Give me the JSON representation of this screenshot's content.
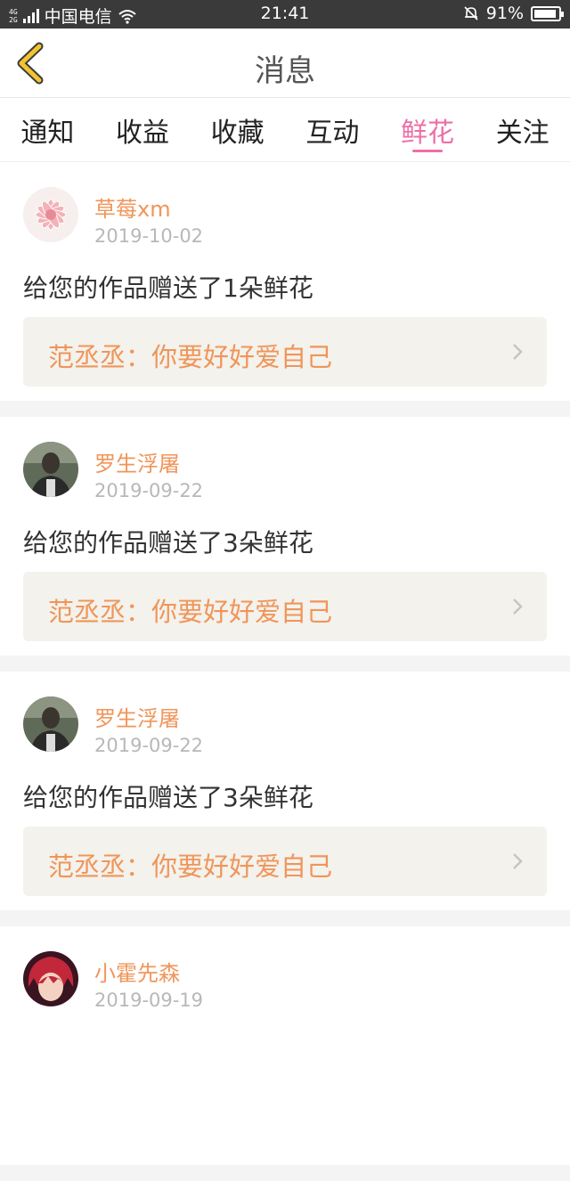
{
  "status_bar": {
    "network_top": "4G",
    "network_bottom": "2G",
    "carrier": "中国电信",
    "time": "21:41",
    "battery": "91%",
    "battery_level": 0.91
  },
  "header": {
    "title": "消息"
  },
  "tabs": [
    {
      "label": "通知",
      "active": false
    },
    {
      "label": "收益",
      "active": false
    },
    {
      "label": "收藏",
      "active": false
    },
    {
      "label": "互动",
      "active": false
    },
    {
      "label": "鲜花",
      "active": true
    },
    {
      "label": "关注",
      "active": false
    }
  ],
  "messages": [
    {
      "name": "草莓xm",
      "date": "2019-10-02",
      "text": "给您的作品赠送了1朵鲜花",
      "quote": "范丞丞：你要好好爱自己",
      "avatar": "flower-avatar"
    },
    {
      "name": "罗生浮屠",
      "date": "2019-09-22",
      "text": "给您的作品赠送了3朵鲜花",
      "quote": "范丞丞：你要好好爱自己",
      "avatar": "person-avatar"
    },
    {
      "name": "罗生浮屠",
      "date": "2019-09-22",
      "text": "给您的作品赠送了3朵鲜花",
      "quote": "范丞丞：你要好好爱自己",
      "avatar": "person-avatar"
    },
    {
      "name": "小霍先森",
      "date": "2019-09-19",
      "text": "",
      "quote": "",
      "avatar": "anime-avatar"
    }
  ],
  "colors": {
    "accent_pink": "#ec6fa7",
    "name_orange": "#f0955a",
    "back_yellow": "#f2c530"
  }
}
